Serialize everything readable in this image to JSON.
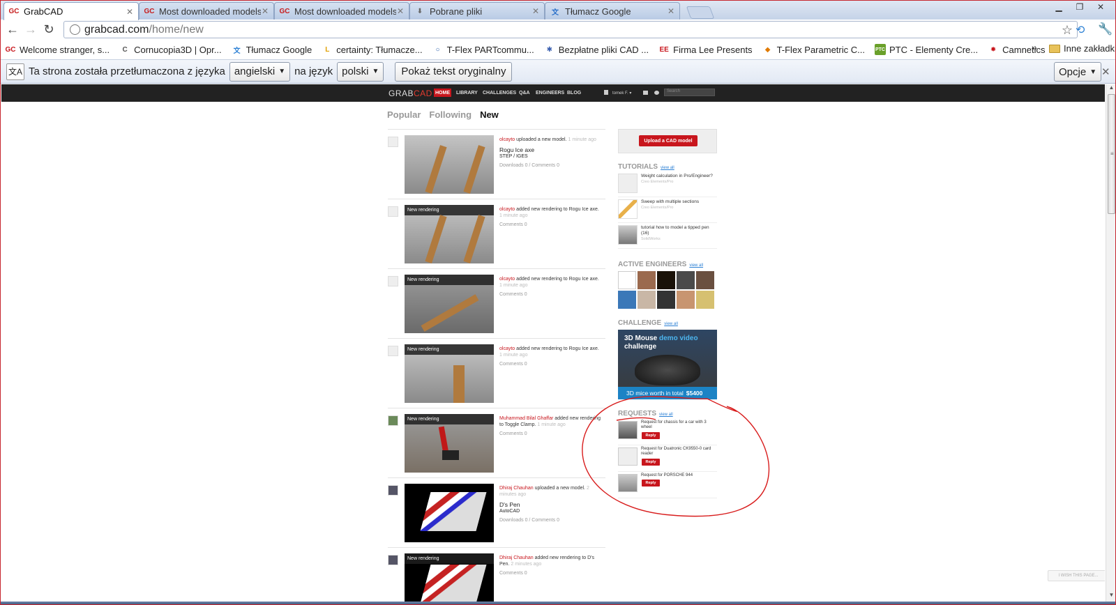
{
  "browser": {
    "tabs": [
      {
        "icon": "GC",
        "title": "GrabCAD",
        "active": true
      },
      {
        "icon": "GC",
        "title": "Most downloaded models -"
      },
      {
        "icon": "GC",
        "title": "Most downloaded models -"
      },
      {
        "icon": "⬇",
        "title": "Pobrane pliki"
      },
      {
        "icon": "文",
        "title": "Tłumacz Google"
      }
    ],
    "url_host": "grabcad.com",
    "url_path": "/home/new",
    "window_controls": {
      "minimize": "▁",
      "maximize": "❐",
      "close": "✕"
    }
  },
  "bookmarks": {
    "items": [
      {
        "icon": "GC",
        "label": "Welcome stranger, s...",
        "color": "#c8161d"
      },
      {
        "icon": "C",
        "label": "Cornucopia3D | Opr...",
        "color": "#555555"
      },
      {
        "icon": "文",
        "label": "Tłumacz Google",
        "color": "#2a7fd4"
      },
      {
        "icon": "L",
        "label": "certainty: Tłumacze...",
        "color": "#e0a000"
      },
      {
        "icon": "○",
        "label": "T-Flex PARTcommu...",
        "color": "#2a5faa"
      },
      {
        "icon": "✱",
        "label": "Bezpłatne pliki CAD ...",
        "color": "#3a5fb0"
      },
      {
        "icon": "EE",
        "label": "Firma Lee Presents",
        "color": "#c8161d"
      },
      {
        "icon": "◆",
        "label": "T-Flex Parametric C...",
        "color": "#e07a00"
      },
      {
        "icon": "PTC",
        "label": "PTC - Elementy Cre...",
        "color": "#6aa02a"
      },
      {
        "icon": "✸",
        "label": "Camnetics",
        "color": "#c8161d"
      }
    ],
    "more": "»",
    "other": "Inne zakładki"
  },
  "translate_bar": {
    "text_before": "Ta strona została przetłumaczona z języka",
    "from_lang": "angielski",
    "text_middle": "na język",
    "to_lang": "polski",
    "show_original": "Pokaż tekst oryginalny",
    "options": "Opcje",
    "close": "✕"
  },
  "site": {
    "logo_main": "GRAB",
    "logo_accent": "CAD",
    "nav": [
      "HOME",
      "LIBRARY",
      "CHALLENGES",
      "Q&A",
      "ENGINEERS",
      "BLOG"
    ],
    "user": "tomek F. ▾",
    "search_placeholder": "Search",
    "feed_tabs": [
      "Popular",
      "Following",
      "New"
    ],
    "feed": [
      {
        "user": "olcayto",
        "action": " uploaded a new model.",
        "time": " 1 minute ago",
        "model": "Rogu Ice axe",
        "format": "STEP / IGES",
        "stats": "Downloads 0 / Comments 0",
        "rendering": ""
      },
      {
        "user": "olcayto",
        "action": " added new rendering to Rogu Ice axe.",
        "time": "1 minute ago",
        "model": "",
        "format": "",
        "stats": "Comments 0",
        "rendering": "New rendering"
      },
      {
        "user": "olcayto",
        "action": " added new rendering to Rogu Ice axe.",
        "time": "1 minute ago",
        "model": "",
        "format": "",
        "stats": "Comments 0",
        "rendering": "New rendering"
      },
      {
        "user": "olcayto",
        "action": " added new rendering to Rogu Ice axe.",
        "time": "1 minute ago",
        "model": "",
        "format": "",
        "stats": "Comments 0",
        "rendering": "New rendering"
      },
      {
        "user": "Muhammad Bilal Ghaffar",
        "action": " added new rendering to Toggle Clamp.",
        "time": " 1 minute ago",
        "model": "",
        "format": "",
        "stats": "Comments 0",
        "rendering": "New rendering"
      },
      {
        "user": "Dhiraj Chauhan",
        "action": " uploaded a new model.",
        "time": " 2 minutes ago",
        "model": "D's Pen",
        "format": "AutoCAD",
        "stats": "Downloads 0 / Comments 0",
        "rendering": ""
      },
      {
        "user": "Dhiraj Chauhan",
        "action": " added new rendering to D's Pen.",
        "time": " 2 minutes ago",
        "model": "",
        "format": "",
        "stats": "Comments 0",
        "rendering": "New rendering"
      }
    ],
    "upload_button": "Upload a CAD model",
    "tutorials_heading": "TUTORIALS",
    "view_all": "view all",
    "tutorials": [
      {
        "title": "Weight calculation in Pro/Engineer?",
        "sub": "Creo Elements/Pro"
      },
      {
        "title": "Sweep with multiple sections",
        "sub": "Creo Elements/Pro"
      },
      {
        "title": "tutorial how to model a tipped pen (16)",
        "sub": "SolidWorks"
      }
    ],
    "engineers_heading": "ACTIVE ENGINEERS",
    "challenge_heading": "CHALLENGE",
    "challenge": {
      "line1": "3D Mouse ",
      "line1_hl": "demo video",
      "line2": "challenge",
      "prize_text": "3D mice worth in total",
      "prize": "$5400"
    },
    "requests_heading": "REQUESTS",
    "requests": [
      {
        "title": "Request for chassis for a car with 3 wheel",
        "reply": "Reply"
      },
      {
        "title": "Request for Duatronic CK9550-0 card reader",
        "reply": "Reply"
      },
      {
        "title": "Request for PORSCHE 944",
        "reply": "Reply"
      }
    ],
    "wish_button": "I WISH THIS PAGE..."
  }
}
